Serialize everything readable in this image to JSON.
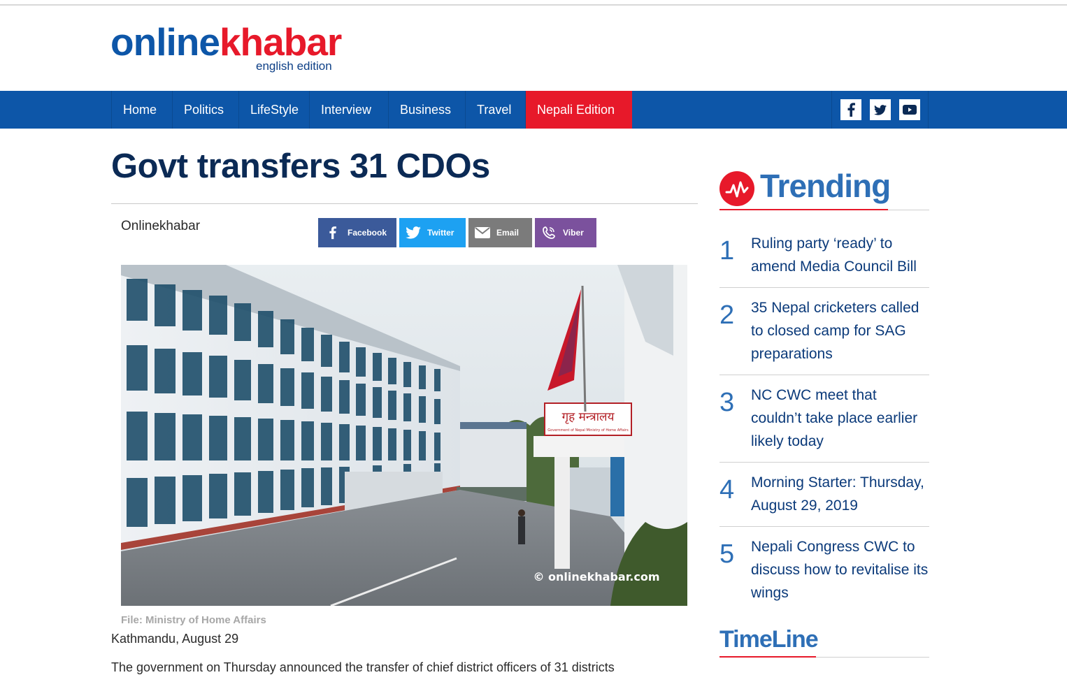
{
  "logo": {
    "part1": "online",
    "part2": "khabar",
    "subtitle": "english edition"
  },
  "nav": {
    "items": [
      {
        "label": "Home"
      },
      {
        "label": "Politics"
      },
      {
        "label": "LifeStyle"
      },
      {
        "label": "Interview"
      },
      {
        "label": "Business"
      },
      {
        "label": "Travel"
      },
      {
        "label": "Nepali Edition"
      }
    ],
    "social": [
      "facebook-icon",
      "twitter-icon",
      "youtube-icon"
    ]
  },
  "article": {
    "title": "Govt transfers 31 CDOs",
    "author": "Onlinekhabar",
    "share": {
      "facebook": "Facebook",
      "twitter": "Twitter",
      "email": "Email",
      "viber": "Viber"
    },
    "photo_sign_nepali": "गृह मन्त्रालय",
    "photo_sign_english": "Government of Nepal Ministry of Home Affairs",
    "photo_watermark": "© onlinekhabar.com",
    "caption": "File: Ministry of Home Affairs",
    "dateline": "Kathmandu, August 29",
    "body_start": "The government on Thursday announced the transfer of chief district officers of 31 districts"
  },
  "sidebar": {
    "trending_title": "Trending",
    "trending": [
      {
        "num": "1",
        "text": "Ruling party ‘ready’ to amend Media Council Bill"
      },
      {
        "num": "2",
        "text": "35 Nepal cricketers called to closed camp for SAG preparations"
      },
      {
        "num": "3",
        "text": "NC CWC meet that couldn’t take place earlier likely today"
      },
      {
        "num": "4",
        "text": "Morning Starter: Thursday, August 29, 2019"
      },
      {
        "num": "5",
        "text": "Nepali Congress CWC to discuss how to revitalise its wings"
      }
    ],
    "timeline_title": "TimeLine"
  },
  "colors": {
    "brand_blue": "#0d56a8",
    "brand_red": "#e7192a",
    "title_navy": "#0b2a55",
    "accent_blue": "#2e6fb6"
  }
}
